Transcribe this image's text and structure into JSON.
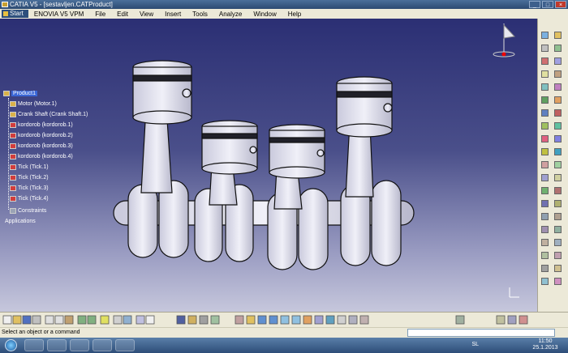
{
  "window": {
    "title": "CATIA V5 - [sestavljen.CATProduct]",
    "minimize": "_",
    "restore": "□",
    "close": "×"
  },
  "menubar": {
    "items": [
      "Start",
      "ENOVIA V5 VPM",
      "File",
      "Edit",
      "View",
      "Insert",
      "Tools",
      "Analyze",
      "Window",
      "Help"
    ]
  },
  "tree": {
    "root": "Product1",
    "children": [
      "Motor (Motor.1)",
      "Crank Shaft (Crank Shaft.1)",
      "kordorob (kordorob.1)",
      "kordorob (kordorob.2)",
      "kordorob (kordorob.3)",
      "kordorob (kordorob.4)",
      "Tick (Tick.1)",
      "Tick (Tick.2)",
      "Tick (Tick.3)",
      "Tick (Tick.4)",
      "Constraints"
    ],
    "footer": "Applications"
  },
  "statusbar": {
    "message": "Select an object or a command",
    "command_value": ""
  },
  "taskbar": {
    "language": "SL",
    "time": "11:50",
    "date": "25.1.2013"
  },
  "colors": {
    "viewport_top": "#2b2f74",
    "viewport_bottom": "#c6c7dc",
    "part_fill": "#dcdcec",
    "ring_dark": "#202028"
  }
}
